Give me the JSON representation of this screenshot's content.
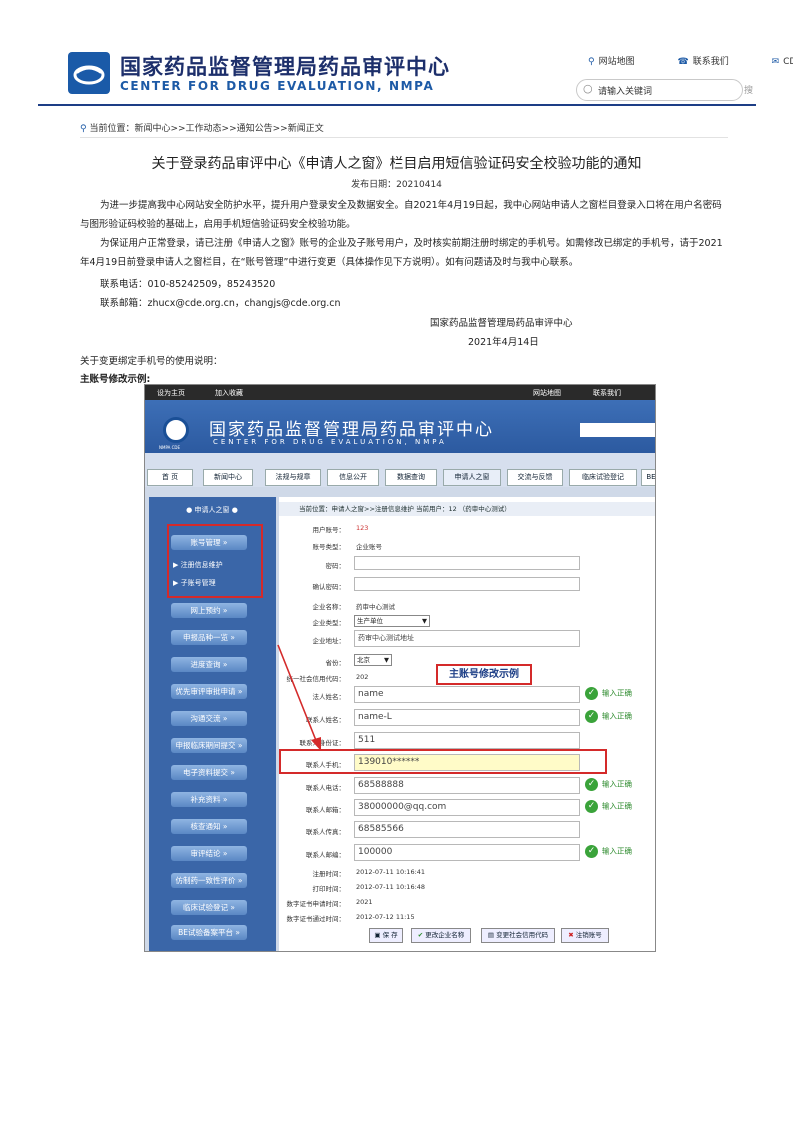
{
  "header": {
    "title_cn": "国家药品监督管理局药品审评中心",
    "title_en": "CENTER FOR DRUG EVALUATION, NMPA",
    "links": [
      "网站地图",
      "联系我们",
      "CD"
    ],
    "search_placeholder": "请输入关键词",
    "search_button": "搜"
  },
  "breadcrumb": "当前位置：新闻中心>>工作动态>>通知公告>>新闻正文",
  "article": {
    "title": "关于登录药品审评中心《申请人之窗》栏目启用短信验证码安全校验功能的通知",
    "pubdate": "发布日期：20210414",
    "para1": "为进一步提高我中心网站安全防护水平，提升用户登录安全及数据安全。自2021年4月19日起，我中心网站申请人之窗栏目登录入口将在用户名密码与图形验证码校验的基础上，启用手机短信验证码安全校验功能。",
    "para2": "为保证用户正常登录，请已注册《申请人之窗》账号的企业及子账号用户，及时核实前期注册时绑定的手机号。如需修改已绑定的手机号，请于2021年4月19日前登录申请人之窗栏目，在“账号管理”中进行变更（具体操作见下方说明）。如有问题请及时与我中心联系。",
    "phone": "联系电话：010-85242509，85243520",
    "email": "联系邮箱：zhucx@cde.org.cn，changjs@cde.org.cn",
    "signature": "国家药品监督管理局药品审评中心",
    "date": "2021年4月14日",
    "instructions": "关于变更绑定手机号的使用说明：",
    "example_heading": "主账号修改示例:"
  },
  "screenshot": {
    "top_links": [
      "设为主页",
      "加入收藏",
      "网站地图",
      "联系我们"
    ],
    "title_cn": "国家药品监督管理局药品审评中心",
    "title_en": "CENTER FOR DRUG EVALUATION, NMPA",
    "emblem_text": "NMPA CDE",
    "tabs": [
      "首 页",
      "新闻中心",
      "法规与规章",
      "信息公开",
      "数据查询",
      "申请人之窗",
      "交流与反馈",
      "临床试验登记",
      "BE"
    ],
    "sidebar_head": "申请人之窗",
    "sidebar_items": [
      "账号管理",
      "网上预约",
      "申报品种一览",
      "进度查询",
      "优先审评审批申请",
      "沟通交流",
      "申报临床期间提交",
      "电子资料提交",
      "补充资料",
      "核查通知",
      "审评结论",
      "仿制药一致性评价",
      "临床试验登记",
      "BE试验备案平台"
    ],
    "sidebar_sub": [
      "注册信息维护",
      "子账号管理"
    ],
    "crumb": "当前位置：申请人之窗>>注册信息维护      当前用户：12      （药审中心测试）",
    "fields": {
      "user_no_label": "用户账号：",
      "user_no": "123",
      "acct_type_label": "账号类型：",
      "acct_type": "企业账号",
      "pwd_label": "密码：",
      "pwd2_label": "确认密码：",
      "company_label": "企业名称：",
      "company": "药审中心测试",
      "ctype_label": "企业类型：",
      "ctype": "生产单位",
      "addr_label": "企业地址：",
      "addr": "药审中心测试地址",
      "prov_label": "省份：",
      "prov": "北京",
      "credit_label": "统一社会信用代码：",
      "credit": "202",
      "legal_label": "法人姓名：",
      "legal": "name",
      "contact_label": "联系人姓名：",
      "contact": "name-L",
      "idcard_label": "联系人身份证：",
      "idcard": "511",
      "mobile_label": "联系人手机：",
      "mobile": "139010******",
      "tel_label": "联系人电话：",
      "tel": "68588888",
      "mail_label": "联系人邮箱：",
      "mail": "38000000@qq.com",
      "fax_label": "联系人传真：",
      "fax": "68585566",
      "zip_label": "联系人邮编：",
      "zip": "100000",
      "reg_label": "注册时间：",
      "reg": "2012-07-11 10:16:41",
      "print_label": "打印时间：",
      "print": "2012-07-11 10:16:48",
      "cert_req_label": "数字证书申请时间：",
      "cert_req": "2021",
      "cert_ok_label": "数字证书通过时间：",
      "cert_ok": "2012-07-12 11:15"
    },
    "ok_text": "输入正确",
    "callout": "主账号修改示例",
    "buttons": [
      "保 存",
      "更改企业名称",
      "变更社会信用代码",
      "注销账号"
    ]
  }
}
